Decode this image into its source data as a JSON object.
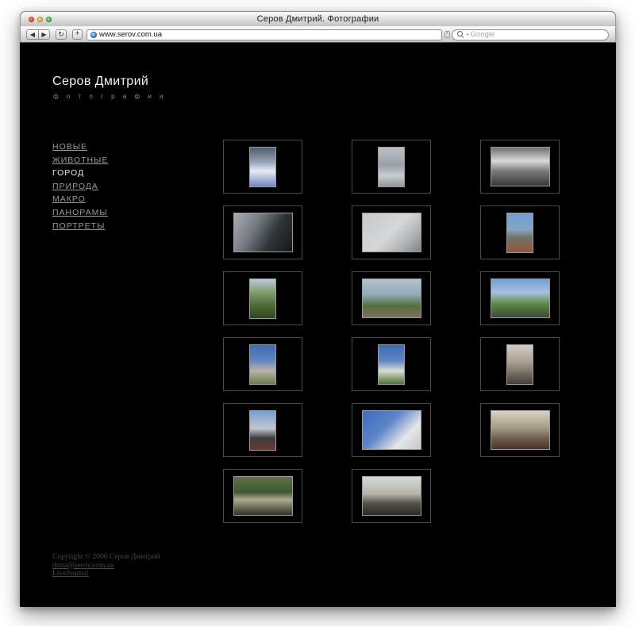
{
  "browser": {
    "window_title": "Серов Дмитрий. Фотографии",
    "back_glyph": "◀",
    "forward_glyph": "▶",
    "reload_glyph": "↻",
    "add_glyph": "+",
    "address_url": "www.serov.com.ua",
    "field_divider_glyph": "˄",
    "search_caret_glyph": "▾",
    "search_placeholder": "Google"
  },
  "site": {
    "title": "Серов Дмитрий",
    "subtitle": "ф о т о г р а ф и и"
  },
  "nav": {
    "items": [
      {
        "id": "novye",
        "label": "НОВЫЕ",
        "active": false
      },
      {
        "id": "zhivotnye",
        "label": "ЖИВОТНЫЕ",
        "active": false
      },
      {
        "id": "gorod",
        "label": "ГОРОД",
        "active": true
      },
      {
        "id": "priroda",
        "label": "ПРИРОДА",
        "active": false
      },
      {
        "id": "makro",
        "label": "МАКРО",
        "active": false
      },
      {
        "id": "panoramy",
        "label": "ПАНОРАМЫ",
        "active": false
      },
      {
        "id": "portrety",
        "label": "ПОРТРЕТЫ",
        "active": false
      }
    ]
  },
  "gallery": {
    "thumbnails": [
      {
        "name": "winter-alley",
        "orientation": "portrait",
        "angle": 180,
        "stops": [
          "#515b6e 0%",
          "#98a4b8 38%",
          "#e8edf4 60%",
          "#6f87c2 100%"
        ]
      },
      {
        "name": "snowy-path-bw",
        "orientation": "portrait",
        "angle": 180,
        "stops": [
          "#b9c0c6 0%",
          "#9aa1a8 45%",
          "#c9cdd1 72%",
          "#8f959b 100%"
        ]
      },
      {
        "name": "park-road-bw",
        "orientation": "landscape",
        "angle": 180,
        "stops": [
          "#6e6e6e 0%",
          "#d9d9d9 35%",
          "#7a7a7a 62%",
          "#383838 100%"
        ]
      },
      {
        "name": "dark-building",
        "orientation": "landscape",
        "angle": 120,
        "stops": [
          "#a8adb4 0%",
          "#767b82 35%",
          "#2f3437 65%",
          "#15181a 100%"
        ]
      },
      {
        "name": "tower-bw",
        "orientation": "landscape",
        "angle": 135,
        "stops": [
          "#c6c8ca 0%",
          "#d6d7d8 50%",
          "#a8abad 80%",
          "#7d8082 100%"
        ]
      },
      {
        "name": "statue-blue-sky",
        "orientation": "portrait",
        "angle": 180,
        "stops": [
          "#6f9ed6 0%",
          "#88a4c0 42%",
          "#6f7462 62%",
          "#96543c 100%"
        ]
      },
      {
        "name": "green-tree",
        "orientation": "portrait",
        "angle": 180,
        "stops": [
          "#bcc9d6 0%",
          "#7f9a6a 35%",
          "#49682f 70%",
          "#2f4722 100%"
        ]
      },
      {
        "name": "lake-shore",
        "orientation": "landscape",
        "angle": 180,
        "stops": [
          "#b4c4cc 0%",
          "#93aab8 40%",
          "#52703b 70%",
          "#80715a 100%"
        ]
      },
      {
        "name": "river-bridge",
        "orientation": "landscape",
        "angle": 180,
        "stops": [
          "#6f9ed6 0%",
          "#a8c2dc 35%",
          "#5c8841 65%",
          "#3c4a3c 100%"
        ]
      },
      {
        "name": "columns-cloud",
        "orientation": "portrait",
        "angle": 180,
        "stops": [
          "#3f6db6 0%",
          "#5d83c2 38%",
          "#b9b4a6 66%",
          "#6a7a4e 100%"
        ]
      },
      {
        "name": "white-tower",
        "orientation": "portrait",
        "angle": 180,
        "stops": [
          "#3c6cb4 0%",
          "#5c86c4 40%",
          "#dcdcd2 66%",
          "#4a7434 100%"
        ]
      },
      {
        "name": "sepia-tree",
        "orientation": "portrait",
        "angle": 180,
        "stops": [
          "#d4ccc0 0%",
          "#a89f92 45%",
          "#6a6257 78%",
          "#46403a 100%"
        ]
      },
      {
        "name": "statue-monument",
        "orientation": "portrait",
        "angle": 180,
        "stops": [
          "#74a0d4 0%",
          "#c2c8cc 45%",
          "#3c3c3c 70%",
          "#6e3a2c 100%"
        ]
      },
      {
        "name": "colonnade-sky",
        "orientation": "landscape",
        "angle": 135,
        "stops": [
          "#3c6cc0 0%",
          "#5c84c8 40%",
          "#e4e6e8 72%",
          "#c4c8cc 100%"
        ]
      },
      {
        "name": "autumn-square",
        "orientation": "landscape",
        "angle": 180,
        "stops": [
          "#d6d2c4 0%",
          "#a49a84 45%",
          "#6a5a48 75%",
          "#4c3228 100%"
        ]
      },
      {
        "name": "rotunda-park",
        "orientation": "landscape",
        "angle": 180,
        "stops": [
          "#5a7446 0%",
          "#3e5830 40%",
          "#b0a890 60%",
          "#2c3424 100%"
        ]
      },
      {
        "name": "statue-square",
        "orientation": "landscape",
        "angle": 180,
        "stops": [
          "#d4d8da 0%",
          "#b4b4a8 45%",
          "#54504a 70%",
          "#2c2824 100%"
        ]
      }
    ]
  },
  "footer": {
    "copyright": "Copyright © 2006 Серов Дмитрий",
    "email": "dima@serov.com.ua",
    "livejournal": "LiveJournal"
  },
  "colors": {
    "page_background": "#000000",
    "nav_link": "#9a9a9a",
    "nav_active": "#e9e9e9",
    "cell_border": "#4a4a4a",
    "thumb_border": "#9a9a9a",
    "footer_text": "#484848"
  }
}
